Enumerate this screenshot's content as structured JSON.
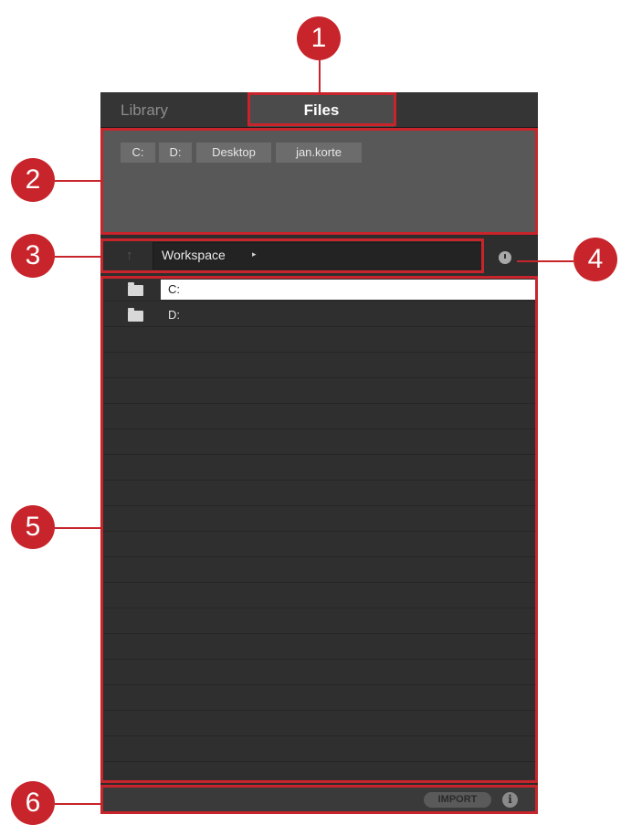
{
  "tabs": [
    {
      "label": "Library"
    },
    {
      "label": "Files"
    }
  ],
  "favorites": [
    "C:",
    "D:",
    "Desktop",
    "jan.korte"
  ],
  "location": {
    "path_label": "Workspace",
    "arrow": "▸",
    "up_icon": "↑"
  },
  "files": [
    {
      "name": "C:",
      "selected": true,
      "icon": "folder-icon"
    },
    {
      "name": "D:",
      "selected": false,
      "icon": "folder-icon"
    }
  ],
  "bottom": {
    "import_label": "IMPORT",
    "info_label": "i"
  },
  "callouts": [
    "1",
    "2",
    "3",
    "4",
    "5",
    "6"
  ],
  "colors": {
    "accent": "#c8242b",
    "panel": "#2b2b2b",
    "favorites_bg": "#585858"
  }
}
